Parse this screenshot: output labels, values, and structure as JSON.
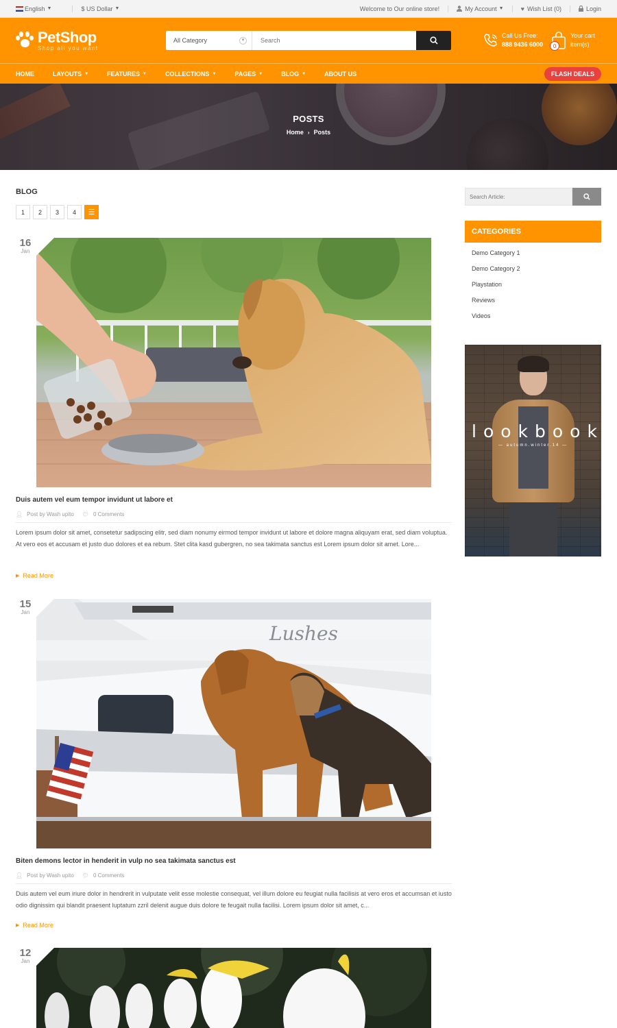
{
  "topbar": {
    "language": "English",
    "currency": "$ US Dollar",
    "welcome": "Welcome to Our online store!",
    "account": "My Account",
    "wishlist": "Wish List (0)",
    "login": "Login"
  },
  "header": {
    "logo_name": "PetShop",
    "logo_tagline": "Shop all you want",
    "category_select": "All Category",
    "search_placeholder": "Search",
    "call_label": "Call Us Free:",
    "call_number": "888 9436 6000",
    "cart_label": "Your cart",
    "cart_items": "item(s)",
    "cart_count": "0"
  },
  "nav": {
    "items": [
      {
        "label": "HOME",
        "dropdown": false
      },
      {
        "label": "LAYOUTS",
        "dropdown": true
      },
      {
        "label": "FEATURES",
        "dropdown": true
      },
      {
        "label": "COLLECTIONS",
        "dropdown": true
      },
      {
        "label": "PAGES",
        "dropdown": true
      },
      {
        "label": "BLOG",
        "dropdown": true
      },
      {
        "label": "ABOUT US",
        "dropdown": false
      }
    ],
    "flash_deals": "FLASH DEALS"
  },
  "banner": {
    "title": "POSTS",
    "breadcrumb_home": "Home",
    "breadcrumb_current": "Posts"
  },
  "blog": {
    "title": "BLOG",
    "pages": [
      "1",
      "2",
      "3",
      "4"
    ],
    "list_view_icon": "☰",
    "posts": [
      {
        "day": "16",
        "month": "Jan",
        "image": "dog-eating-photo",
        "title": "Duis autem vel eum tempor invidunt ut labore et",
        "author": "Post by Wash upito",
        "comments": "0 Comments",
        "excerpt": "Lorem ipsum dolor sit amet, consetetur sadipscing elitr, sed diam nonumy eirmod tempor invidunt ut labore et dolore magna aliquyam erat, sed diam voluptua. At vero eos et accusam et justo duo dolores et ea rebum. Stet clita kasd gubergren, no sea takimata sanctus est Lorem ipsum dolor sit amet. Lore...",
        "read_more": "Read More"
      },
      {
        "day": "15",
        "month": "Jan",
        "image": "dogs-on-boat-photo",
        "title": "Biten demons lector in henderit in vulp no sea takimata sanctus est",
        "author": "Post by Wash upito",
        "comments": "0 Comments",
        "excerpt": "Duis autem vel eum iriure dolor in hendrerit in vulputate velit esse molestie consequat, vel illum dolore eu feugiat nulla facilisis at vero eros et accumsan et iusto odio dignissim qui blandit praesent luptatum zzril delenit augue duis dolore te feugait nulla facilisi. Lorem ipsum dolor sit amet, c...",
        "read_more": "Read More"
      },
      {
        "day": "12",
        "month": "Jan",
        "image": "cockatoos-photo"
      }
    ]
  },
  "sidebar": {
    "search_placeholder": "Search Article:",
    "categories_title": "CATEGORIES",
    "categories": [
      "Demo Category 1",
      "Demo Category 2",
      "Playstation",
      "Reviews",
      "Videos"
    ],
    "lookbook_title": "lookbook",
    "lookbook_sub": "— autumn.winter.14 —"
  },
  "colors": {
    "accent": "#ff9400",
    "flash": "#e9413d",
    "dark": "#222222"
  }
}
